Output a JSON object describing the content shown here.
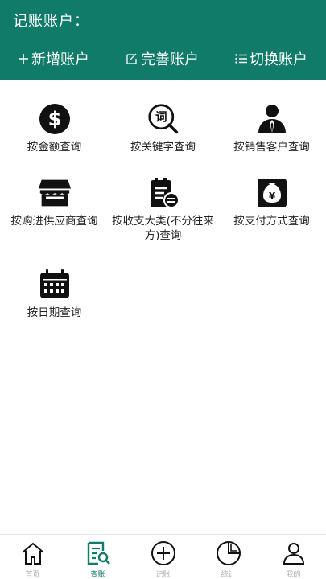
{
  "header": {
    "account_label": "记账账户：",
    "actions": [
      {
        "label": "新增账户",
        "icon": "plus-icon"
      },
      {
        "label": "完善账户",
        "icon": "edit-icon"
      },
      {
        "label": "切换账户",
        "icon": "list-icon"
      }
    ]
  },
  "query_options": [
    {
      "label": "按金额查询",
      "icon": "dollar-icon"
    },
    {
      "label": "按关键字查询",
      "icon": "keyword-search-icon"
    },
    {
      "label": "按销售客户查询",
      "icon": "customer-icon"
    },
    {
      "label": "按购进供应商查询",
      "icon": "store-icon"
    },
    {
      "label": "按收支大类(不分往来方)查询",
      "icon": "category-list-icon"
    },
    {
      "label": "按支付方式查询",
      "icon": "money-bag-icon"
    },
    {
      "label": "按日期查询",
      "icon": "calendar-icon"
    }
  ],
  "tabbar": [
    {
      "label": "首页",
      "icon": "home-icon",
      "active": false
    },
    {
      "label": "查账",
      "icon": "ledger-search-icon",
      "active": true
    },
    {
      "label": "记账",
      "icon": "plus-circle-icon",
      "active": false
    },
    {
      "label": "统计",
      "icon": "pie-chart-icon",
      "active": false
    },
    {
      "label": "我的",
      "icon": "user-icon",
      "active": false
    }
  ],
  "colors": {
    "primary": "#0f7b68",
    "tab_inactive": "#aaaaaa",
    "icon": "#111111"
  }
}
